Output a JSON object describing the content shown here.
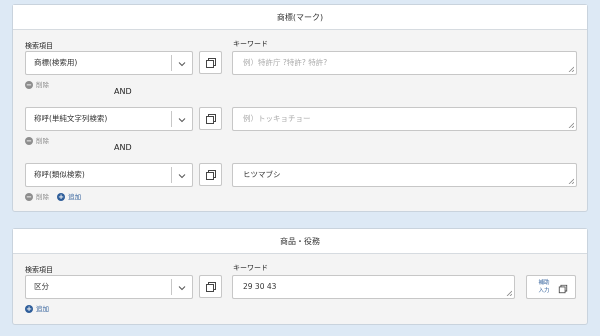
{
  "trademark_panel": {
    "title": "商標(マーク)",
    "search_item_label": "検索項目",
    "keyword_label": "キーワード",
    "delete_label": "削除",
    "add_label": "追加",
    "and_label": "AND",
    "rows": [
      {
        "select_value": "商標(検索用)",
        "keyword_value": "",
        "keyword_placeholder": "例）特許庁 ?特許? 特許?"
      },
      {
        "select_value": "称呼(単純文字列検索)",
        "keyword_value": "",
        "keyword_placeholder": "例）トッキョチョー"
      },
      {
        "select_value": "称呼(類似検索)",
        "keyword_value": "ヒツマブシ",
        "keyword_placeholder": ""
      }
    ]
  },
  "goods_panel": {
    "title": "商品・役務",
    "search_item_label": "検索項目",
    "keyword_label": "キーワード",
    "select_value": "区分",
    "keyword_value": "29 30 43",
    "helper_button_label": "補助入力",
    "helper_line1": "補助",
    "helper_line2": "入力",
    "add_label": "追加"
  },
  "icons": {
    "minus": "−",
    "plus": "+"
  }
}
